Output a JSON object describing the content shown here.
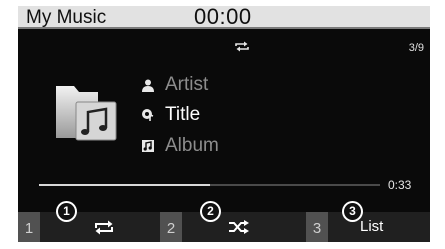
{
  "header": {
    "app_title": "My Music",
    "clock": "00:00"
  },
  "status": {
    "repeat_icon": "repeat-icon",
    "track_counter": "3/9"
  },
  "track": {
    "album_art_icon": "music-folder-icon",
    "artist": "Artist",
    "title": "Title",
    "album": "Album",
    "artist_icon": "person-icon",
    "title_icon": "song-title-icon",
    "album_icon": "album-icon"
  },
  "progress": {
    "elapsed": "0:33",
    "fraction": 0.5
  },
  "softkeys": [
    {
      "number": "1",
      "icon": "repeat-icon"
    },
    {
      "number": "2",
      "icon": "shuffle-icon"
    },
    {
      "number": "3",
      "label": "List"
    }
  ],
  "callouts": [
    "1",
    "2",
    "3"
  ],
  "colors": {
    "header_bg": "#e2e2e2",
    "screen_bg": "#0a0a0a",
    "softkey_bar": "#202020",
    "key_number_bg": "#515151"
  }
}
